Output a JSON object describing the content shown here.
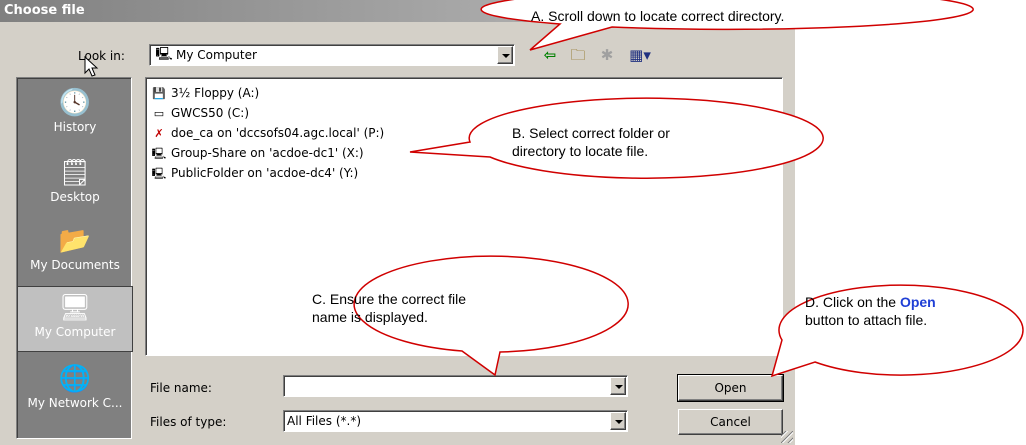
{
  "dialog": {
    "title": "Choose file",
    "look_in_label": "Look in:",
    "look_in_value": "My Computer",
    "toolbar_icons": [
      "back-icon",
      "up-folder-icon",
      "new-folder-icon",
      "views-menu-icon"
    ]
  },
  "places": [
    {
      "label": "History",
      "icon": "history-icon",
      "selected": false
    },
    {
      "label": "Desktop",
      "icon": "desktop-icon",
      "selected": false
    },
    {
      "label": "My Documents",
      "icon": "my-documents-icon",
      "selected": false
    },
    {
      "label": "My Computer",
      "icon": "my-computer-icon",
      "selected": true
    },
    {
      "label": "My Network C...",
      "icon": "network-icon",
      "selected": false
    }
  ],
  "files": [
    {
      "label": "3½ Floppy (A:)",
      "icon": "floppy-drive-icon"
    },
    {
      "label": "GWCS50 (C:)",
      "icon": "hard-drive-icon"
    },
    {
      "label": "doe_ca on 'dccsofs04.agc.local' (P:)",
      "icon": "disconnected-network-drive-icon"
    },
    {
      "label": "Group-Share on 'acdoe-dc1' (X:)",
      "icon": "network-drive-icon"
    },
    {
      "label": "PublicFolder on 'acdoe-dc4' (Y:)",
      "icon": "network-drive-icon"
    }
  ],
  "fields": {
    "file_name_label": "File name:",
    "file_name_value": "",
    "file_type_label": "Files of type:",
    "file_type_value": "All Files (*.*)"
  },
  "buttons": {
    "open": "Open",
    "cancel": "Cancel"
  },
  "callouts": {
    "a": "A. Scroll down to locate correct directory.",
    "b_line1": "B. Select correct folder or",
    "b_line2": "directory to locate file.",
    "c_line1": "C. Ensure the correct file",
    "c_line2": "name is displayed.",
    "d_line1_pre": "D. Click on the ",
    "d_line1_bold": "Open",
    "d_line2": "button to  attach file."
  }
}
